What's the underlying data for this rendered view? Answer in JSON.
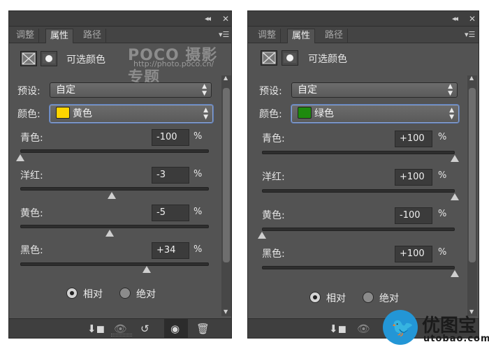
{
  "left": {
    "tabs": [
      "调整",
      "属性",
      "路径"
    ],
    "title": "可选颜色",
    "watermark": {
      "brand": "POCO 摄影专题",
      "url": "http://photo.poco.cn/"
    },
    "preset_label": "预设:",
    "preset_value": "自定",
    "color_label": "颜色:",
    "color_value": "黄色",
    "color_swatch": "#ffd400",
    "sliders": [
      {
        "label": "青色:",
        "value": "-100",
        "level_percent": -100
      },
      {
        "label": "洋红:",
        "value": "-3",
        "level_percent": -3
      },
      {
        "label": "黄色:",
        "value": "-5",
        "level_percent": -5
      },
      {
        "label": "黑色:",
        "value": "+34",
        "level_percent": 34
      }
    ],
    "percent_sign": "%",
    "radio_relative": "相对",
    "radio_absolute": "绝对"
  },
  "right": {
    "tabs": [
      "调整",
      "属性",
      "路径"
    ],
    "title": "可选颜色",
    "preset_label": "预设:",
    "preset_value": "自定",
    "color_label": "颜色:",
    "color_value": "绿色",
    "color_swatch": "#1e8a0e",
    "sliders": [
      {
        "label": "青色:",
        "value": "+100",
        "level_percent": 100
      },
      {
        "label": "洋红:",
        "value": "+100",
        "level_percent": 100
      },
      {
        "label": "黄色:",
        "value": "-100",
        "level_percent": -100
      },
      {
        "label": "黑色:",
        "value": "+100",
        "level_percent": 100
      }
    ],
    "percent_sign": "%",
    "radio_relative": "相对",
    "radio_absolute": "绝对"
  },
  "logo": {
    "name": "优图宝",
    "url": "utobao.com"
  },
  "icons": {
    "collapse": "double-chevron-icon",
    "close": "close-icon",
    "menu": "panel-menu-icon",
    "clip": "clip-to-layer-icon",
    "view_prev": "view-previous-icon",
    "reset": "reset-icon",
    "visibility": "eye-icon",
    "delete": "trash-icon"
  }
}
